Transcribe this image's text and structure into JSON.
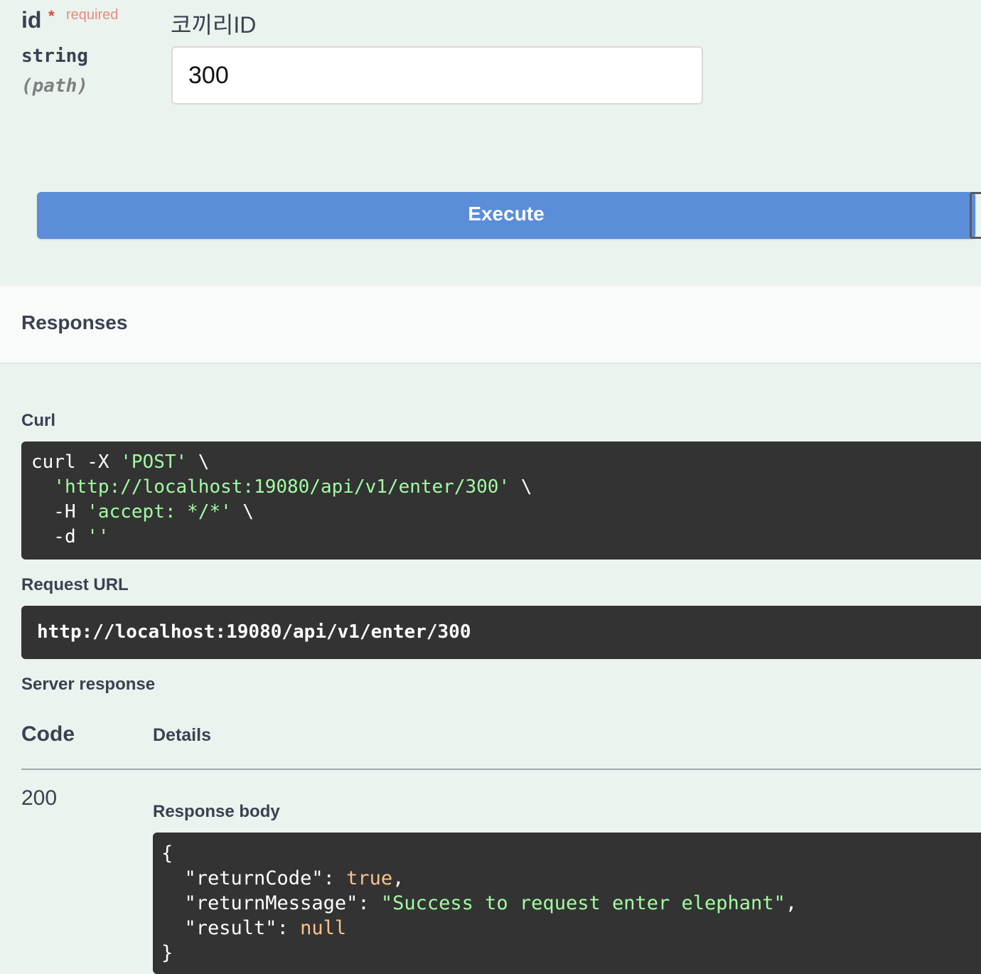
{
  "parameter": {
    "name": "id",
    "required_star": "*",
    "required_label": "required",
    "type": "string",
    "in": "(path)",
    "description": "코끼리ID",
    "value": "300"
  },
  "execute_label": "Execute",
  "responses": {
    "title": "Responses",
    "curl_label": "Curl",
    "curl": {
      "line1_cmd": "curl -X ",
      "line1_method": "'POST'",
      "line1_tail": " \\",
      "line2_indent": "  ",
      "line2_url": "'http://localhost:19080/api/v1/enter/300'",
      "line2_tail": " \\",
      "line3_flag": "  -H ",
      "line3_header": "'accept: */*'",
      "line3_tail": " \\",
      "line4_flag": "  -d ",
      "line4_data": "''"
    },
    "request_url_label": "Request URL",
    "request_url": "http://localhost:19080/api/v1/enter/300",
    "server_response_label": "Server response",
    "table": {
      "code_header": "Code",
      "details_header": "Details"
    },
    "code": "200",
    "response_body_label": "Response body",
    "body": {
      "open": "{",
      "k1": "  \"returnCode\"",
      "v1": "true",
      "k2": "  \"returnMessage\"",
      "v2": "\"Success to request enter elephant\"",
      "k3": "  \"result\"",
      "v3": "null",
      "close": "}"
    }
  },
  "colors": {
    "execute_bg": "#5b8dd9",
    "code_bg": "#333333",
    "string": "#a2fca2",
    "literal": "#fcc28c",
    "required": "#e88a7e"
  }
}
